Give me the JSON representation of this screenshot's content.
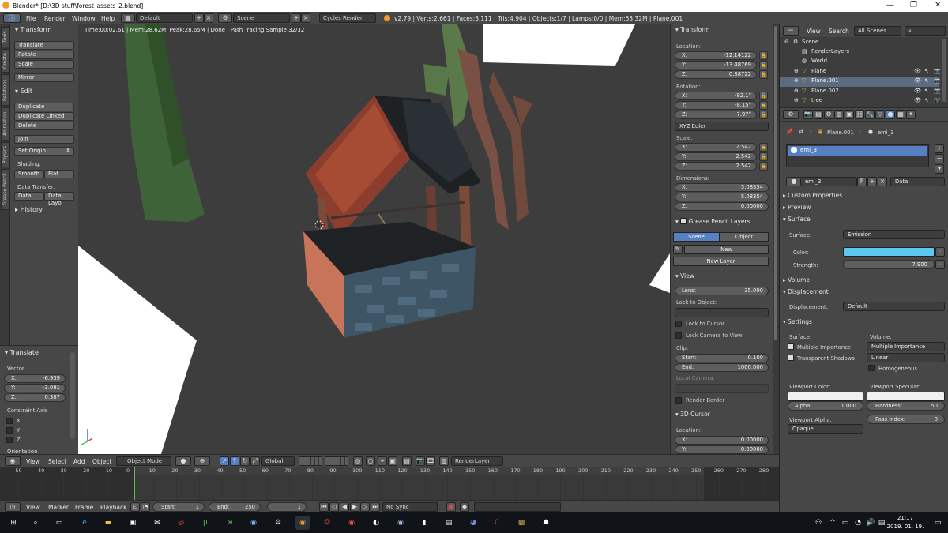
{
  "window": {
    "title": "Blender* [D:\\3D stuff\\forest_assets_2.blend]"
  },
  "menu": {
    "items": [
      "File",
      "Render",
      "Window",
      "Help"
    ],
    "layout": "Default",
    "scene": "Scene",
    "engine": "Cycles Render",
    "stats": "v2.79 | Verts:2,661 | Faces:3,111 | Tris:4,904 | Objects:1/7 | Lamps:0/0 | Mem:53.32M | Plane.001"
  },
  "left_tabs": [
    "Tools",
    "Create",
    "Relations",
    "Animation",
    "Physics",
    "Grease Pencil"
  ],
  "tools": {
    "transform_header": "Transform",
    "translate": "Translate",
    "rotate": "Rotate",
    "scale": "Scale",
    "mirror": "Mirror",
    "edit_header": "Edit",
    "duplicate": "Duplicate",
    "duplicate_linked": "Duplicate Linked",
    "delete": "Delete",
    "join": "Join",
    "set_origin": "Set Origin",
    "shading_label": "Shading:",
    "smooth": "Smooth",
    "flat": "Flat",
    "data_transfer_label": "Data Transfer:",
    "data": "Data",
    "data_layo": "Data Layo",
    "history_header": "History"
  },
  "redo": {
    "header": "Translate",
    "vector_label": "Vector",
    "x": "-6.939",
    "y": "-3.081",
    "z": "0.387",
    "x_label": "X:",
    "y_label": "Y:",
    "z_label": "Z:",
    "constraint_label": "Constraint Axis",
    "cx": "X",
    "cy": "Y",
    "cz": "Z",
    "orientation_label": "Orientation"
  },
  "viewport": {
    "info": "Time:00:02.61 | Mem:28.62M, Peak:28.65M | Done | Path Tracing Sample 32/32"
  },
  "npanel": {
    "transform_header": "Transform",
    "location_label": "Location:",
    "loc_x": "-12.14122",
    "loc_y": "-13.48769",
    "loc_z": "0.38722",
    "rotation_label": "Rotation:",
    "rot_x": "-82.1°",
    "rot_y": "-8.15°",
    "rot_z": "7.97°",
    "rotation_mode": "XYZ Euler",
    "scale_label": "Scale:",
    "scl_x": "2.542",
    "scl_y": "2.542",
    "scl_z": "2.542",
    "dimensions_label": "Dimensions:",
    "dim_x": "5.08354",
    "dim_y": "5.08354",
    "dim_z": "0.00000",
    "x_label": "X:",
    "y_label": "Y:",
    "z_label": "Z:",
    "gp_header": "Grease Pencil Layers",
    "gp_scene": "Scene",
    "gp_object": "Object",
    "gp_new": "New",
    "gp_new_layer": "New Layer",
    "view_header": "View",
    "lens_label": "Lens:",
    "lens": "35.000",
    "lock_object_label": "Lock to Object:",
    "lock_cursor": "Lock to Cursor",
    "lock_camera": "Lock Camera to View",
    "clip_label": "Clip:",
    "clip_start_label": "Start:",
    "clip_start": "0.100",
    "clip_end_label": "End:",
    "clip_end": "1000.000",
    "local_camera_label": "Local Camera:",
    "render_border": "Render Border",
    "cursor_header": "3D Cursor",
    "cursor_location_label": "Location:",
    "cur_x": "0.00000",
    "cur_y": "0.00000"
  },
  "vhead": {
    "view": "View",
    "select": "Select",
    "add": "Add",
    "object": "Object",
    "mode": "Object Mode",
    "orientation": "Global",
    "render_layer": "RenderLayer"
  },
  "timeline": {
    "ticks": [
      "-50",
      "-40",
      "-30",
      "-20",
      "-10",
      "0",
      "10",
      "20",
      "30",
      "40",
      "50",
      "60",
      "70",
      "80",
      "90",
      "100",
      "110",
      "120",
      "130",
      "140",
      "150",
      "160",
      "170",
      "180",
      "190",
      "200",
      "210",
      "220",
      "230",
      "240",
      "250",
      "260",
      "270",
      "280"
    ],
    "current_frame": 1,
    "view": "View",
    "marker": "Marker",
    "frame": "Frame",
    "playback": "Playback",
    "start_label": "Start:",
    "start": "1",
    "end_label": "End:",
    "end": "250",
    "current": "1",
    "sync": "No Sync"
  },
  "outliner": {
    "view": "View",
    "search": "Search",
    "filter": "All Scenes",
    "items": [
      "Scene",
      "RenderLayers",
      "World",
      "Plane",
      "Plane.001",
      "Plane.002",
      "tree"
    ]
  },
  "props": {
    "breadcrumb_object": "Plane.001",
    "breadcrumb_material": "emi_3",
    "material_slot": "emi_3",
    "material_name": "emi_3",
    "link": "Data",
    "users_field": "F",
    "custom_props": "Custom Properties",
    "preview": "Preview",
    "surface_header": "Surface",
    "surface_label": "Surface:",
    "surface": "Emission",
    "color_label": "Color:",
    "color": "#5cc8f0",
    "strength_label": "Strength:",
    "strength": "7.900",
    "volume": "Volume",
    "displacement_header": "Displacement",
    "displacement_label": "Displacement:",
    "displacement": "Default",
    "settings_header": "Settings",
    "s_surface_label": "Surface:",
    "s_volume_label": "Volume:",
    "multiple_importance": "Multiple Importance",
    "transparent_shadows": "Transparent Shadows",
    "volume_sampling": "Multiple Importance",
    "interpolation": "Linear",
    "homogeneous": "Homogeneous",
    "viewport_color_label": "Viewport Color:",
    "viewport_specular_label": "Viewport Specular:",
    "alpha_label": "Alpha:",
    "alpha": "1.000",
    "hardness_label": "Hardness:",
    "hardness": "50",
    "viewport_alpha_label": "Viewport Alpha:",
    "viewport_alpha": "Opaque",
    "pass_index_label": "Pass Index:",
    "pass_index": "0"
  },
  "taskbar": {
    "time": "21:17",
    "date": "2019. 01. 19."
  }
}
